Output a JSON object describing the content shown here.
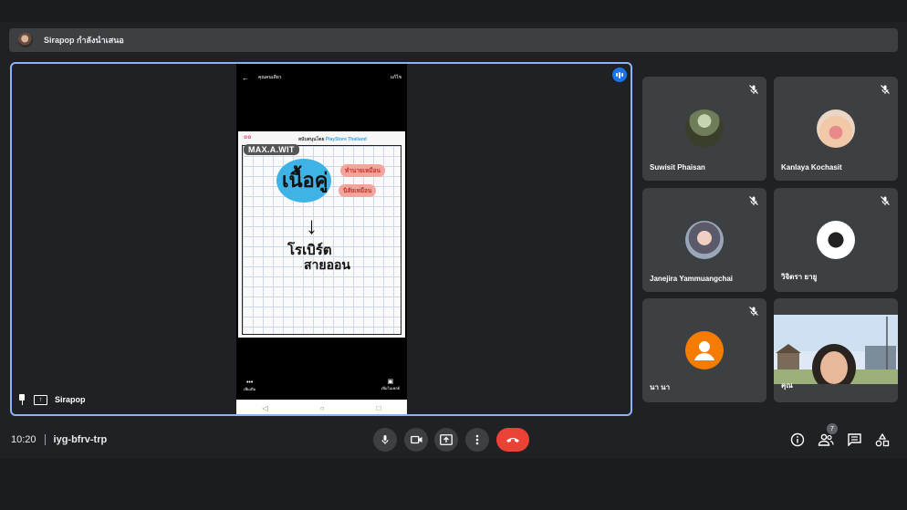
{
  "banner": {
    "text": "Sirapop กำลังนำเสนอ"
  },
  "presentation": {
    "presenter_name": "Sirapop",
    "phone": {
      "top_title": "คุณคนเดียว",
      "top_right": "แก้ไข",
      "brand": "MAX.A.WIT",
      "sponsor_prefix": "สนับสนุนโดย",
      "sponsor_name": "PlayStore Thailand",
      "headline": "เนื้อคู่",
      "pill_1": "ทำนายเหมือน",
      "pill_2": "นิสัยเหมือน",
      "arrow": "↓",
      "line_1": "โรเบิร์ต",
      "line_2": "สายออน",
      "bottom_left": "เพิ่มเติม",
      "bottom_right": "เพิ่มในเพลย์"
    }
  },
  "participants": [
    {
      "name": "Suwisit Phaisan",
      "muted": true
    },
    {
      "name": "Kanlaya Kochasit",
      "muted": true
    },
    {
      "name": "Janejira Yammuangchai",
      "muted": true
    },
    {
      "name": "วิจิตรา ยายู",
      "muted": true
    },
    {
      "name": "นา นา",
      "muted": true
    },
    {
      "name": "คุณ",
      "muted": false
    }
  ],
  "meeting": {
    "time": "10:20",
    "code": "iyg-bfrv-trp",
    "participant_count": "7"
  },
  "icons": {
    "mic": "microphone-icon",
    "camera": "camera-icon",
    "present": "present-screen-icon",
    "more": "more-options-icon",
    "end": "end-call-icon",
    "info": "info-icon",
    "people": "people-icon",
    "chat": "chat-icon",
    "activities": "activities-icon"
  },
  "colors": {
    "accent": "#8ab4f8",
    "end_call": "#ea4335",
    "tile_bg": "#3c4043",
    "page_bg": "#202124",
    "avatar_orange": "#f57c00"
  }
}
